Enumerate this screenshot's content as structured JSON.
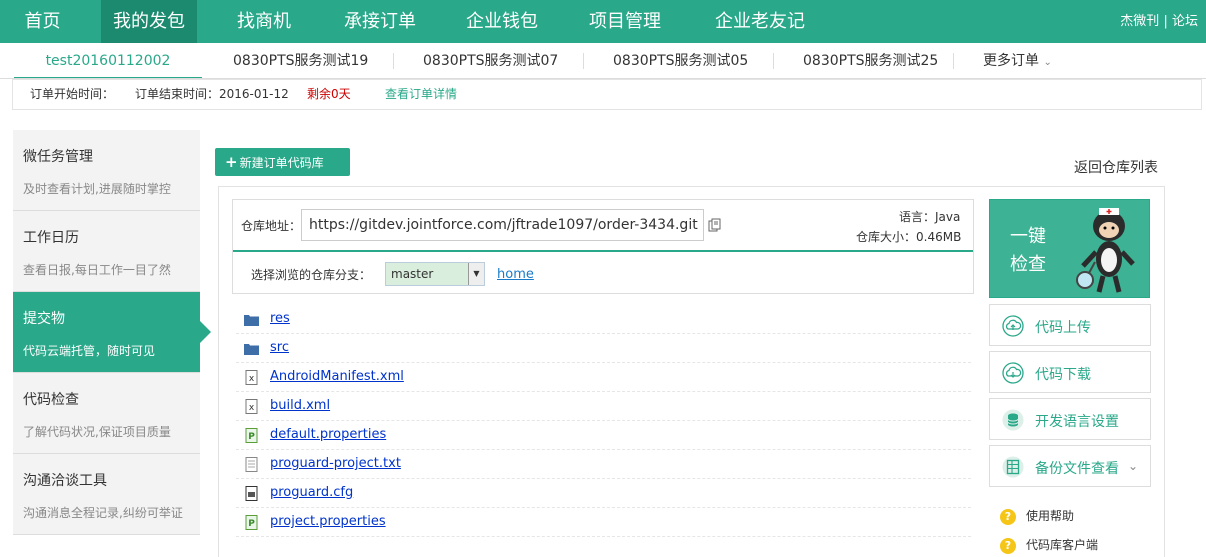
{
  "nav": {
    "items": [
      "首页",
      "我的发包",
      "找商机",
      "承接订单",
      "企业钱包",
      "项目管理",
      "企业老友记"
    ],
    "active_index": 1,
    "right_links": [
      "杰微刊",
      "论坛"
    ],
    "separator": "|"
  },
  "order_tabs": {
    "items": [
      "test20160112002",
      "0830PTS服务测试19",
      "0830PTS服务测试07",
      "0830PTS服务测试05",
      "0830PTS服务测试25"
    ],
    "active_index": 0,
    "more_label": "更多订单"
  },
  "info": {
    "start_label": "订单开始时间：",
    "end_label": "订单结束时间：2016-01-12",
    "remaining": "剩余0天",
    "detail_link": "查看订单详情"
  },
  "sidebar": [
    {
      "title": "微任务管理",
      "desc": "及时查看计划,进展随时掌控"
    },
    {
      "title": "工作日历",
      "desc": "查看日报,每日工作一目了然"
    },
    {
      "title": "提交物",
      "desc": "代码云端托管，随时可见"
    },
    {
      "title": "代码检查",
      "desc": "了解代码状况,保证项目质量"
    },
    {
      "title": "沟通洽谈工具",
      "desc": "沟通消息全程记录,纠纷可举证"
    }
  ],
  "sidebar_active_index": 2,
  "actions": {
    "new_repo": "新建订单代码库",
    "back_to_list": "返回仓库列表"
  },
  "repo": {
    "url_label": "仓库地址：",
    "url": "https://gitdev.jointforce.com/jftrade1097/order-3434.git",
    "language": "语言：Java",
    "size": "仓库大小：0.46MB",
    "branch_label": "选择浏览的仓库分支：",
    "branch": "master",
    "home_link": "home"
  },
  "files": [
    {
      "name": "res",
      "icon": "folder-icon"
    },
    {
      "name": "src",
      "icon": "folder-icon"
    },
    {
      "name": "AndroidManifest.xml",
      "icon": "xml-file-icon"
    },
    {
      "name": "build.xml",
      "icon": "xml-file-icon"
    },
    {
      "name": "default.properties",
      "icon": "properties-file-icon"
    },
    {
      "name": "proguard-project.txt",
      "icon": "text-file-icon"
    },
    {
      "name": "proguard.cfg",
      "icon": "config-file-icon"
    },
    {
      "name": "project.properties",
      "icon": "properties-file-icon"
    }
  ],
  "right": {
    "check_line1": "一键",
    "check_line2": "检查",
    "upload": "代码上传",
    "download": "代码下载",
    "lang_settings": "开发语言设置",
    "backup_view": "备份文件查看",
    "help": "使用帮助",
    "client": "代码库客户端"
  },
  "colors": {
    "brand": "#2aa88a",
    "brand_dark": "#1b8a6f",
    "link": "#0033cc",
    "warn": "#cc0000"
  }
}
